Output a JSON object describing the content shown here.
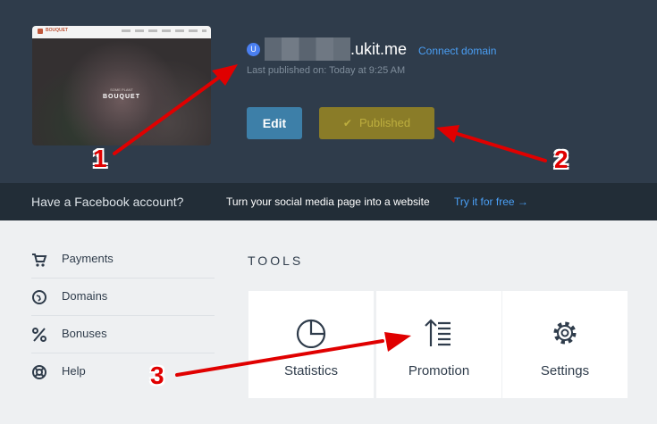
{
  "thumbnail": {
    "logo_text": "BOUQUET",
    "subtitle": "SOME PLANT",
    "title": "BOUQUET"
  },
  "site": {
    "avatar_letter": "U",
    "domain_suffix": ".ukit.me",
    "connect_label": "Connect domain",
    "last_published": "Last published on: Today at 9:25 AM"
  },
  "buttons": {
    "edit": "Edit",
    "published": "Published",
    "published_icon": "check-icon"
  },
  "facebook_banner": {
    "question": "Have a Facebook account?",
    "description": "Turn your social media page into a website",
    "cta": "Try it for free →"
  },
  "sidebar": {
    "items": [
      {
        "label": "Payments",
        "icon": "cart-icon"
      },
      {
        "label": "Domains",
        "icon": "globe-icon"
      },
      {
        "label": "Bonuses",
        "icon": "percent-icon"
      },
      {
        "label": "Help",
        "icon": "lifebuoy-icon"
      }
    ]
  },
  "tools": {
    "title": "TOOLS",
    "cards": [
      {
        "label": "Statistics",
        "icon": "pie-chart-icon"
      },
      {
        "label": "Promotion",
        "icon": "sort-arrow-list-icon"
      },
      {
        "label": "Settings",
        "icon": "gear-icon"
      }
    ]
  },
  "annotations": {
    "markers": [
      "1",
      "2",
      "3"
    ],
    "color": "#e00000"
  },
  "colors": {
    "header_bg": "#2f3c4b",
    "banner_bg": "#222d37",
    "link": "#4a9ff5",
    "edit_button": "#3d7fa8",
    "published_button": "#8a7c28"
  }
}
